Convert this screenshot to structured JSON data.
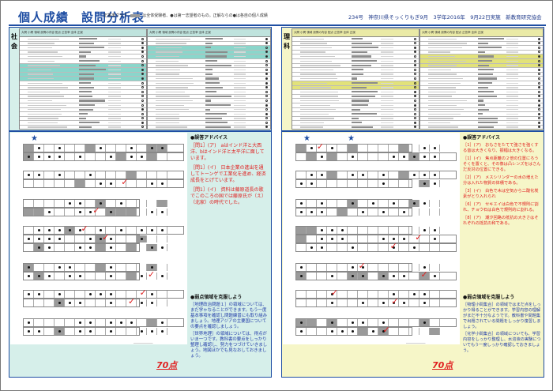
{
  "header": {
    "title": "個人成績　設問分析表",
    "legend": "正答率グラフ",
    "legend_note": "は全体受験者、●は第一志望者のもの。正解ならの●は各自の個人成績",
    "right": "234号　神奈川県そっくりもぎ9月　3学年2016年　9月22日実施　新教育研究協会"
  },
  "subjects": {
    "social": {
      "label": "社会",
      "score": "70点"
    },
    "science": {
      "label": "理科",
      "score": "70点"
    }
  },
  "social_tables": {
    "t1_head": "大問 小問 領域 設問の内容 配点 正答率 全体 正誤",
    "t2_head": "大問 小問 領域 設問の内容 配点 正答率 全体 正誤"
  },
  "science_tables": {
    "t1_head": "大問 小問 領域 設問の内容 配点 正答率 全体 正誤",
    "t2_head": "大問 小問 領域 設問の内容 配点 正答率 全体 正誤"
  },
  "social_advice": {
    "h1": "●誤答アドバイス",
    "a1": "［問1］(ア)　aはインド洋と大西洋、bはインド洋と太平洋に面しています。",
    "a2": "［問1］(イ)　日本企業の進出を通してトーンゲで工業化を進め、経済成長をとげています。",
    "a3": "［問1］(イ)　資料は藤原道長の歌でこのころの国では藤原氏が（え）（北家）の時代でした。",
    "h2": "●弱点領域を克服しよう",
    "w1": "［地理政治問題１］の領域については、まだ学ゃなることができます。もう一度基本事項を確認し問題練習にも取り組みましょう。地理アジアの主要国についての要点を確認しましょう。",
    "w2": "［世界地理］の領域については、得点がいま一つです。教科書の要点をしっかり整理し確認し、努力をつづけていきましょう。地図ほかでも見なおしておきましょう。"
  },
  "science_advice": {
    "h1": "●誤答アドバイス",
    "a1": "［1］(ア)　おもさをたてて強さを強くする音は大きくなり、振幅は大きくなる。",
    "a2": "［1］(イ)　焦点距離の２倍の位置にろうそくを置くと、その像は凸レンズをはさんだ反対の位置にできる。",
    "a3": "［2］(ア)　メスシリンダーの水の増えた分は入れた物質の体積である。",
    "a4": "［3］(イ)　白色で木は空気から二酸化炭素がとり入れられ",
    "a5": "［6］(ア)　セキエイは白色で不規則に割れ、チョウ石は白色で規則的に割れる。",
    "a6": "［8］(ア)　潮汐回路の抵抗の大きさはそれぞれの抵抗の和である。",
    "h2": "●弱点領域を克服しよう",
    "w1": "［物理小問集合］の領域ではまだ点をしっかり得ることができます。学習内容の理解がまだ不十分なようです。教科書や問題集で出題されている問題をしっかり復習しましょう。",
    "w2": "［化学小問集合］の領域についても、学習内容をしっかり整理し、水溶液の実験についてもう一度しっかり確認しておきましょう。"
  }
}
